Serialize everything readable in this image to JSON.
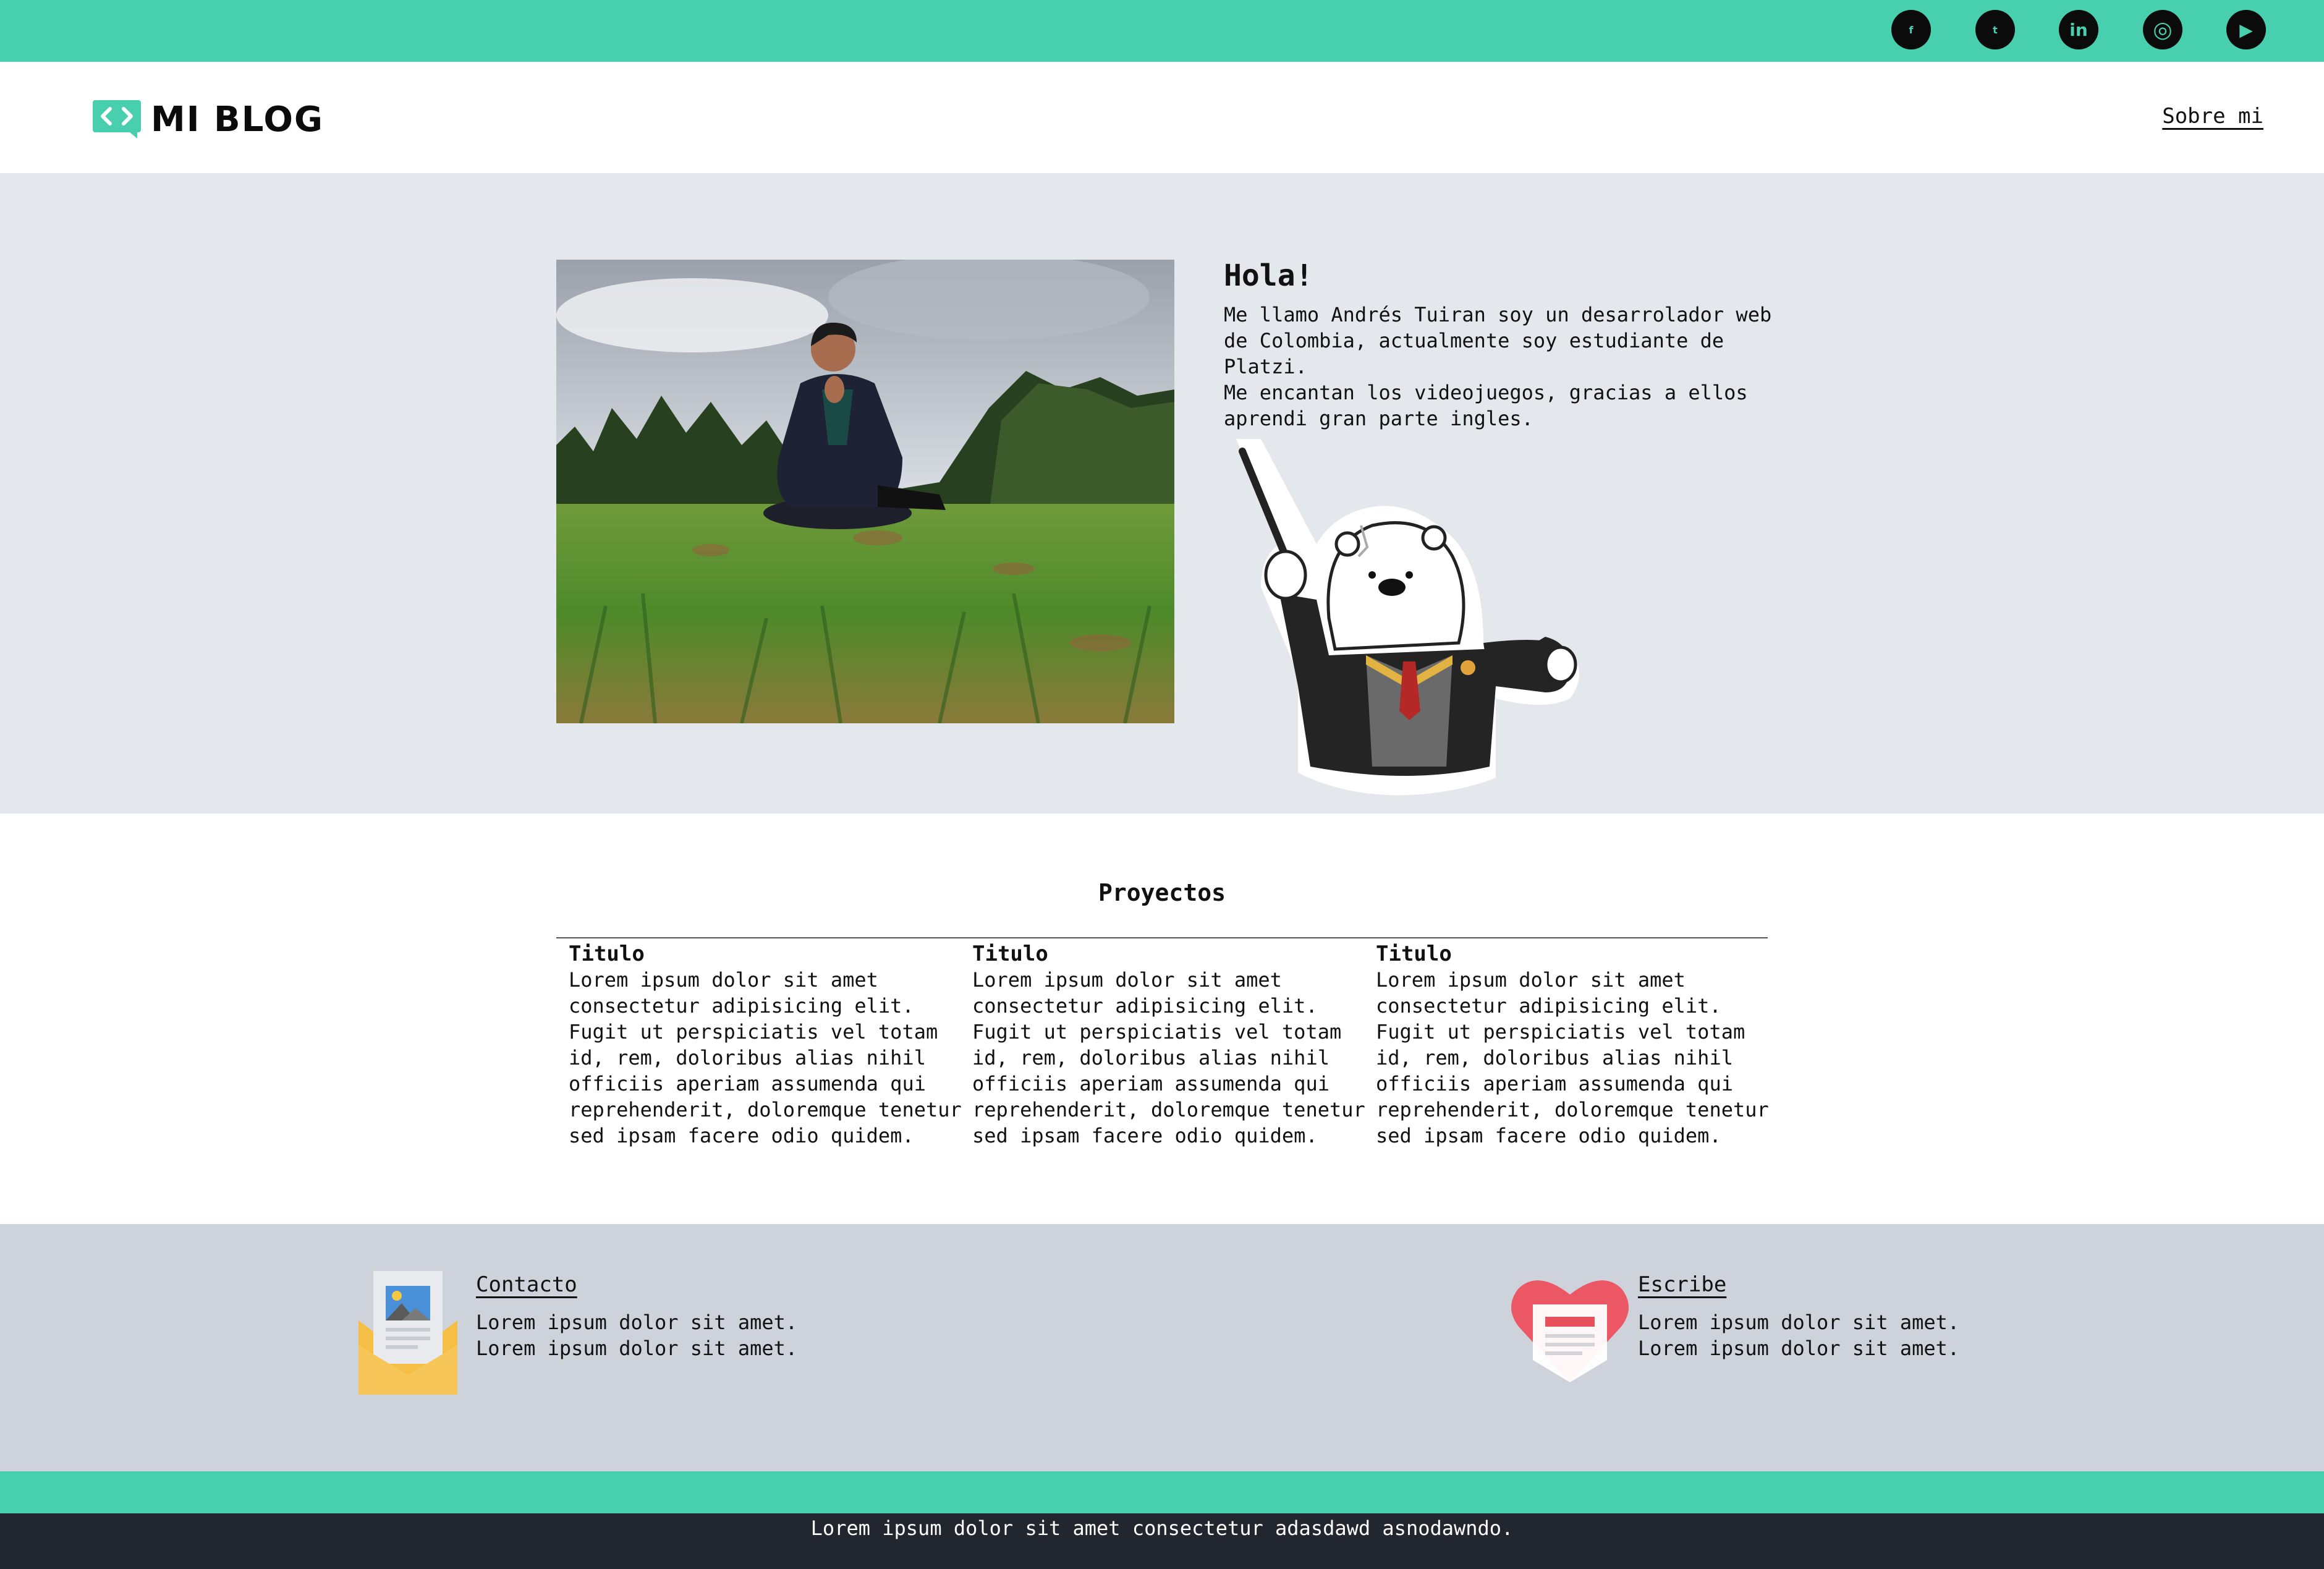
{
  "colors": {
    "accent": "#48cfad",
    "hero_bg": "#e4e7eb",
    "contact_bg": "#ced2da",
    "footer_bg": "#22262e"
  },
  "social_icons": [
    "facebook-icon",
    "tumblr-icon",
    "linkedin-icon",
    "instagram-icon",
    "youtube-icon"
  ],
  "social_glyphs": {
    "facebook": "f",
    "tumblr": "t",
    "linkedin": "in",
    "instagram": "◎",
    "youtube": "▶"
  },
  "header": {
    "logo_text": "MI BLOG",
    "nav_link": "Sobre mi"
  },
  "hero": {
    "title": "Hola!",
    "paragraphs": [
      "Me llamo Andrés Tuiran soy un desarrolador web de Colombia, actualmente soy estudiante de Platzi.",
      "Me encantan los videojuegos, gracias a ellos aprendi gran parte ingles."
    ]
  },
  "projects": {
    "title": "Proyectos",
    "cards": [
      {
        "title": "Titulo",
        "text": "Lorem ipsum dolor sit amet consectetur adipisicing elit. Fugit ut perspiciatis vel totam id, rem, doloribus alias nihil officiis aperiam assumenda qui reprehenderit, doloremque tenetur sed ipsam facere odio quidem."
      },
      {
        "title": "Titulo",
        "text": "Lorem ipsum dolor sit amet consectetur adipisicing elit. Fugit ut perspiciatis vel totam id, rem, doloribus alias nihil officiis aperiam assumenda qui reprehenderit, doloremque tenetur sed ipsam facere odio quidem."
      },
      {
        "title": "Titulo",
        "text": "Lorem ipsum dolor sit amet consectetur adipisicing elit. Fugit ut perspiciatis vel totam id, rem, doloribus alias nihil officiis aperiam assumenda qui reprehenderit, doloremque tenetur sed ipsam facere odio quidem."
      }
    ]
  },
  "contact": {
    "left": {
      "title": "Contacto",
      "line1": "Lorem ipsum dolor sit amet.",
      "line2": "Lorem ipsum dolor sit amet."
    },
    "right": {
      "title": "Escribe",
      "line1": "Lorem ipsum dolor sit amet.",
      "line2": "Lorem ipsum dolor sit amet."
    }
  },
  "footer": {
    "text": "Lorem ipsum dolor sit amet consectetur adasdawd asnodawndo."
  }
}
